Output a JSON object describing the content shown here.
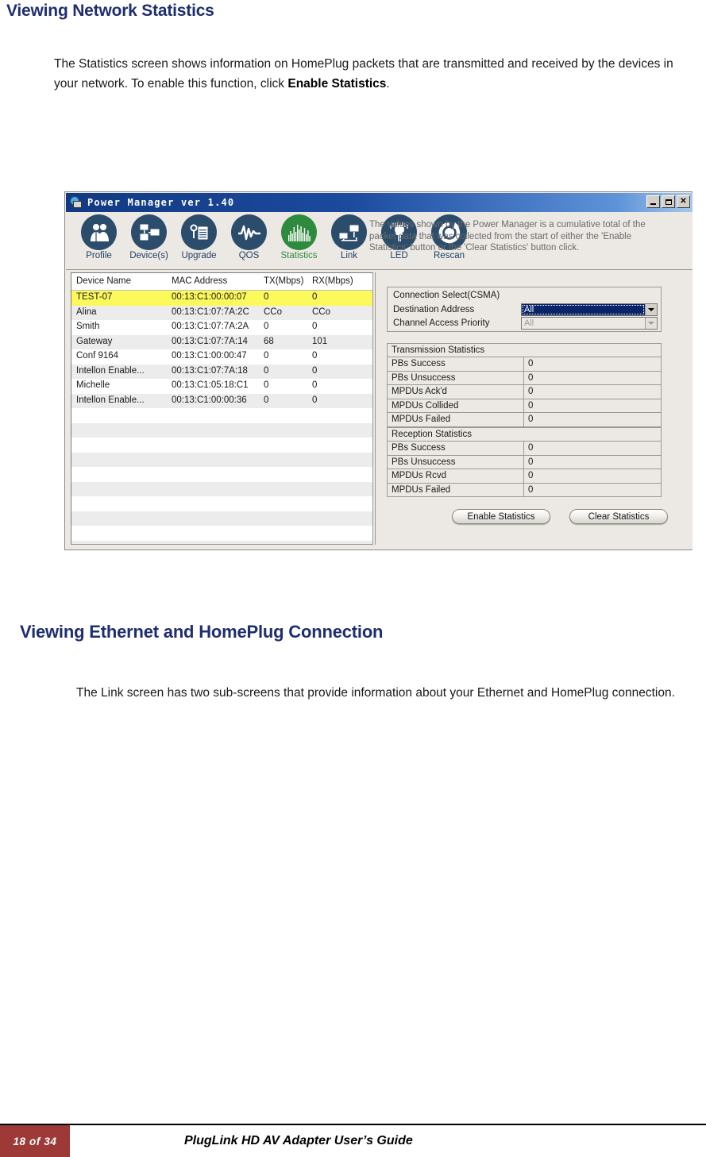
{
  "document": {
    "heading_statistics": "Viewing Network Statistics",
    "para_statistics_before": "The Statistics screen shows information on HomePlug packets that are transmitted and received by the devices in your network. To enable this function, click ",
    "para_statistics_bold": "Enable Statistics",
    "para_statistics_after": ".",
    "heading_connection": "Viewing Ethernet and HomePlug Connection",
    "para_connection": "The Link screen has two sub-screens that provide information about your Ethernet and HomePlug connection.",
    "heading_color": "#1F2E6E"
  },
  "footer": {
    "page": "18 of 34",
    "title": "PlugLink HD AV Adapter User’s Guide",
    "page_box_color": "#9D3A38"
  },
  "app": {
    "title": "Power Manager ver 1.40",
    "titlebar_icon": "globe-monitor-icon",
    "window_controls": [
      {
        "name": "minimize-button",
        "label": ""
      },
      {
        "name": "maximize-button",
        "label": ""
      },
      {
        "name": "close-button",
        "label": "✕"
      }
    ],
    "toolbar": {
      "items": [
        {
          "label": "Profile",
          "icon": "two-people-icon",
          "active": false
        },
        {
          "label": "Device(s)",
          "icon": "computers-icon",
          "active": false
        },
        {
          "label": "Upgrade",
          "icon": "key-document-icon",
          "active": false
        },
        {
          "label": "QOS",
          "icon": "waveform-icon",
          "active": false
        },
        {
          "label": "Statistics",
          "icon": "bar-chart-icon",
          "active": true
        },
        {
          "label": "Link",
          "icon": "network-link-icon",
          "active": false
        },
        {
          "label": "LED",
          "icon": "led-bulb-icon",
          "active": false
        },
        {
          "label": "Rescan",
          "icon": "refresh-power-icon",
          "active": false
        }
      ],
      "note": "The values shown by the Power Manager is a cumulative total of the packet data that was collected from the start of either the 'Enable Statistics' button or the 'Clear Statistics' button click.",
      "active_color": "#2E8B3D",
      "icon_color": "#2C4C6B"
    },
    "device_list": {
      "columns": [
        "Device Name",
        "MAC Address",
        "TX(Mbps)",
        "RX(Mbps)"
      ],
      "rows": [
        {
          "name": "TEST-07",
          "mac": "00:13:C1:00:00:07",
          "tx": "0",
          "rx": "0",
          "selected": true
        },
        {
          "name": "Alina",
          "mac": "00:13:C1:07:7A:2C",
          "tx": "CCo",
          "rx": "CCo",
          "selected": false
        },
        {
          "name": "Smith",
          "mac": "00:13:C1:07:7A:2A",
          "tx": "0",
          "rx": "0",
          "selected": false
        },
        {
          "name": "Gateway",
          "mac": "00:13:C1:07:7A:14",
          "tx": "68",
          "rx": "101",
          "selected": false
        },
        {
          "name": "Conf 9164",
          "mac": "00:13:C1:00:00:47",
          "tx": "0",
          "rx": "0",
          "selected": false
        },
        {
          "name": "Intellon Enable...",
          "mac": "00:13:C1:07:7A:18",
          "tx": "0",
          "rx": "0",
          "selected": false
        },
        {
          "name": "Michelle",
          "mac": "00:13:C1:05:18:C1",
          "tx": "0",
          "rx": "0",
          "selected": false
        },
        {
          "name": "Intellon Enable...",
          "mac": "00:13:C1:00:00:36",
          "tx": "0",
          "rx": "0",
          "selected": false
        }
      ],
      "empty_row_count": 14,
      "selected_row_color": "#FCF95C"
    },
    "connection_select": {
      "title": "Connection Select(CSMA)",
      "destination_label": "Destination Address",
      "destination_value": "All",
      "priority_label": "Channel Access Priority",
      "priority_value": "All",
      "priority_disabled": true
    },
    "transmission_statistics": {
      "title": "Transmission Statistics",
      "rows": [
        {
          "label": "PBs Success",
          "value": "0"
        },
        {
          "label": "PBs Unsuccess",
          "value": "0"
        },
        {
          "label": "MPDUs Ack'd",
          "value": "0"
        },
        {
          "label": "MPDUs Collided",
          "value": "0"
        },
        {
          "label": "MPDUs Failed",
          "value": "0"
        }
      ]
    },
    "reception_statistics": {
      "title": "Reception Statistics",
      "rows": [
        {
          "label": "PBs Success",
          "value": "0"
        },
        {
          "label": "PBs Unsuccess",
          "value": "0"
        },
        {
          "label": "MPDUs Rcvd",
          "value": "0"
        },
        {
          "label": "MPDUs Failed",
          "value": "0"
        }
      ]
    },
    "buttons": {
      "enable": "Enable Statistics",
      "clear": "Clear Statistics"
    }
  }
}
